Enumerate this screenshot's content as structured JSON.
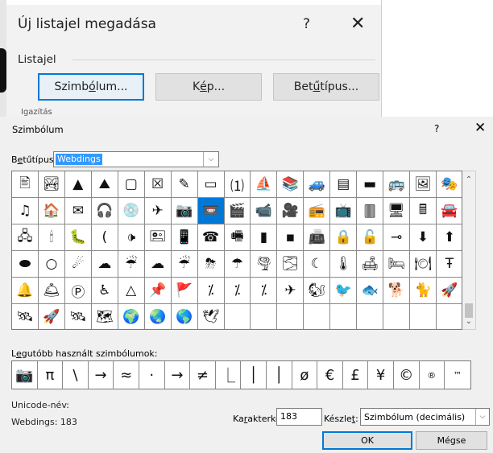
{
  "background_dialog": {
    "title": "Új listajel megadása",
    "help": "?",
    "close": "✕",
    "section_label": "Listajel",
    "buttons": {
      "symbol_pre": "Szimb",
      "symbol_key": "ó",
      "symbol_post": "lum...",
      "picture_pre": "K",
      "picture_key": "é",
      "picture_post": "p...",
      "font_pre": "Bet",
      "font_key": "ű",
      "font_post": "típus..."
    },
    "cut_text": "Igazítás"
  },
  "symbol_dialog": {
    "title": "Szimbólum",
    "help": "?",
    "close": "✕",
    "font_label_pre": "B",
    "font_label_key": "e",
    "font_label_post": "tűtípus:",
    "font_value": "Webdings",
    "dropdown_arrow": "⌵",
    "grid_symbols": [
      "🖹",
      "🏞",
      "▲",
      "⛰",
      "▢",
      "☒",
      "✎",
      "▭",
      "⑴",
      "⛵",
      "📚",
      "🚙",
      "▤",
      "▬",
      "🚌",
      "🖼",
      "🎭",
      "♫",
      "🏠",
      "✉",
      "🎧",
      "💿",
      "✈",
      "📷",
      "📼",
      "🎬",
      "📹",
      "🎥",
      "📻",
      "📺",
      "🀫",
      "🖥",
      "🖩",
      "🚘",
      "🖧",
      "🕯",
      "🐛",
      "(",
      "🕩",
      "🖭",
      "📱",
      "☎",
      "🖷",
      "▮",
      "▪",
      "📠",
      "🔒",
      "🔓",
      "⊸",
      "⬇",
      "⬆",
      "⬬",
      "○",
      "☄",
      "☁",
      "☔",
      "☁",
      "☔",
      "⛈",
      "☂",
      "🌪",
      "🌫",
      "☾",
      "🌡",
      "🛋",
      "🛏",
      "🍽",
      "Ŧ",
      "🔔",
      "🛎",
      "Ⓟ",
      "♿",
      "△",
      "📌",
      "🚩",
      "⁒",
      "⁒",
      "⁒",
      "✈",
      "🐿",
      "🐦",
      "🐟",
      "🐕",
      "🐈",
      "🚀",
      "🛰",
      "🚀",
      "🛰",
      "🗺",
      "🌍",
      "🌏",
      "🌎",
      "🕊",
      "",
      "",
      "",
      "",
      "",
      "",
      "",
      "",
      "",
      ""
    ],
    "selected_index": 24,
    "recent_label_pre": "L",
    "recent_label_key": "e",
    "recent_label_post": "gutóbb használt szimbólumok:",
    "recent_symbols": [
      "📷",
      "π",
      "\\",
      "→",
      "≈",
      "·",
      "→",
      "≠",
      "⎿",
      "│",
      "│",
      "ø",
      "€",
      "£",
      "¥",
      "©",
      "®",
      "™"
    ],
    "unicode_name_label": "Unicode-név:",
    "unicode_name_value": "Webdings: 183",
    "char_code_label_pre": "Ka",
    "char_code_label_key": "r",
    "char_code_label_post": "akterkód:",
    "char_code_value": "183",
    "set_label_pre": "Készle",
    "set_label_key": "t",
    "set_label_post": ":",
    "set_value": "Szimbólum (decimális)",
    "ok_label": "OK",
    "cancel_label": "Mégse",
    "scroll_up": "⌃",
    "scroll_down": "⌄"
  },
  "colors": {
    "selection": "#0078d7",
    "font_highlight": "#3399ff",
    "dialog_bg": "#f0f0f0"
  }
}
